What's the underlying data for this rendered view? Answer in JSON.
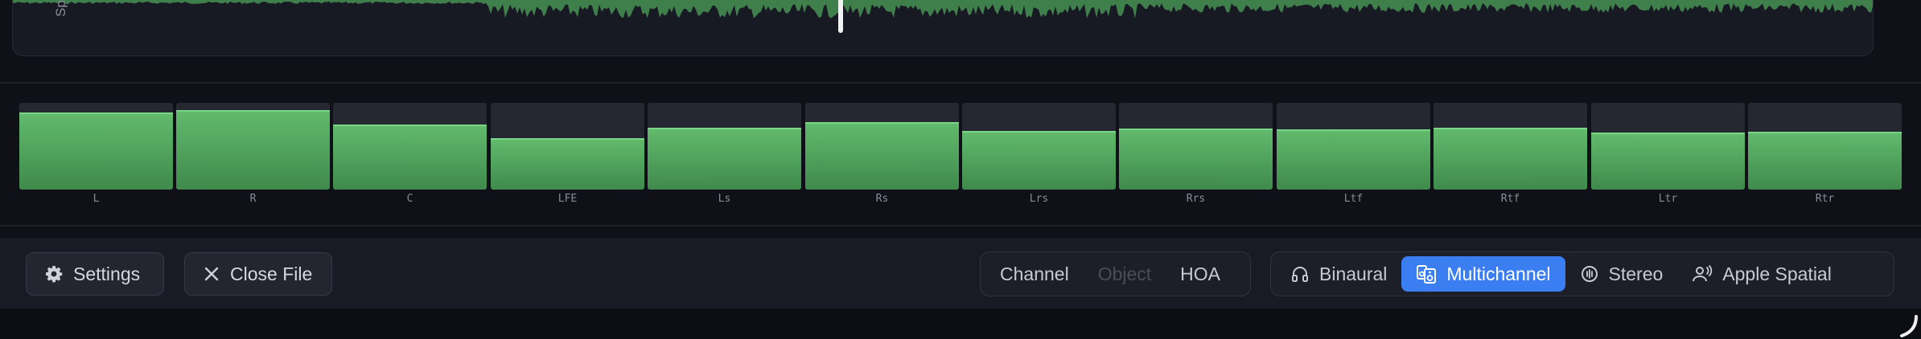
{
  "waveform": {
    "axis_label": "Spa"
  },
  "meters": {
    "channels": [
      {
        "label": "L",
        "level": 0.89
      },
      {
        "label": "R",
        "level": 0.92
      },
      {
        "label": "C",
        "level": 0.75
      },
      {
        "label": "LFE",
        "level": 0.59
      },
      {
        "label": "Ls",
        "level": 0.71
      },
      {
        "label": "Rs",
        "level": 0.78
      },
      {
        "label": "Lrs",
        "level": 0.68
      },
      {
        "label": "Rrs",
        "level": 0.7
      },
      {
        "label": "Ltf",
        "level": 0.69
      },
      {
        "label": "Rtf",
        "level": 0.71
      },
      {
        "label": "Ltr",
        "level": 0.66
      },
      {
        "label": "Rtr",
        "level": 0.67
      }
    ],
    "fill_color": "#5bb267"
  },
  "toolbar": {
    "settings_label": "Settings",
    "close_file_label": "Close File",
    "source_modes": [
      {
        "label": "Channel",
        "state": "enabled"
      },
      {
        "label": "Object",
        "state": "disabled"
      },
      {
        "label": "HOA",
        "state": "enabled"
      }
    ],
    "output_modes": [
      {
        "label": "Binaural",
        "icon": "headphones-icon",
        "state": "normal"
      },
      {
        "label": "Multichannel",
        "icon": "speakers-icon",
        "state": "selected"
      },
      {
        "label": "Stereo",
        "icon": "stereo-icon",
        "state": "normal"
      },
      {
        "label": "Apple Spatial",
        "icon": "spatial-person-icon",
        "state": "normal"
      }
    ],
    "accent_color": "#3a7ef2"
  }
}
